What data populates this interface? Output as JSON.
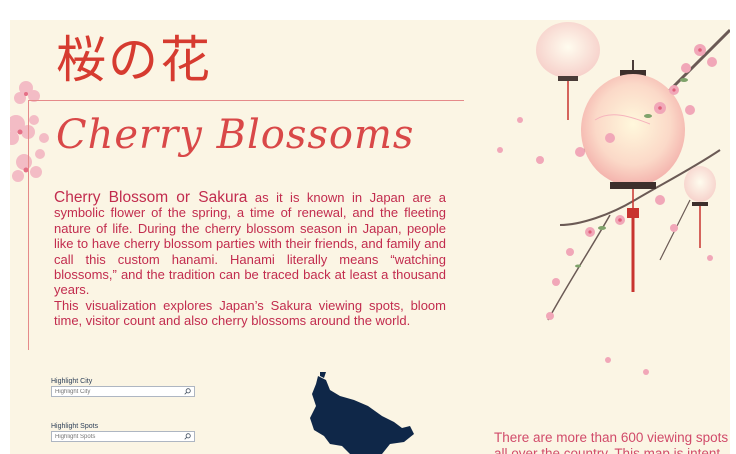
{
  "header": {
    "kanji_title": "桜の花",
    "script_title": "Cherry Blossoms"
  },
  "intro": {
    "lead": "Cherry Blossom or Sakura",
    "paragraph_1_rest": " as it is known in Japan are a symbolic flower of the spring, a time of renewal, and the fleeting nature of life. During the cherry blossom season in Japan, people like to have cherry blossom parties with their friends, and family and call this custom hanami. Hanami literally means “watching blossoms,” and the tradition can be traced back at least a thousand years.",
    "paragraph_2": "This visualization explores Japan’s Sakura viewing spots, bloom time, visitor count and also cherry blossoms around the world."
  },
  "filters": {
    "city": {
      "label": "Highlight City",
      "placeholder": "Highlight City"
    },
    "spots": {
      "label": "Highlight Spots",
      "placeholder": "Highlight Spots"
    }
  },
  "stats": {
    "line_1": "There are more than 600 viewing spots",
    "line_2": "all over the country. This map is intent"
  },
  "icons": {
    "search": "search-icon"
  },
  "colors": {
    "background": "#fbf5e4",
    "title_red": "#d63b30",
    "text_pink": "#c22c4e",
    "map_navy": "#0f2748"
  }
}
